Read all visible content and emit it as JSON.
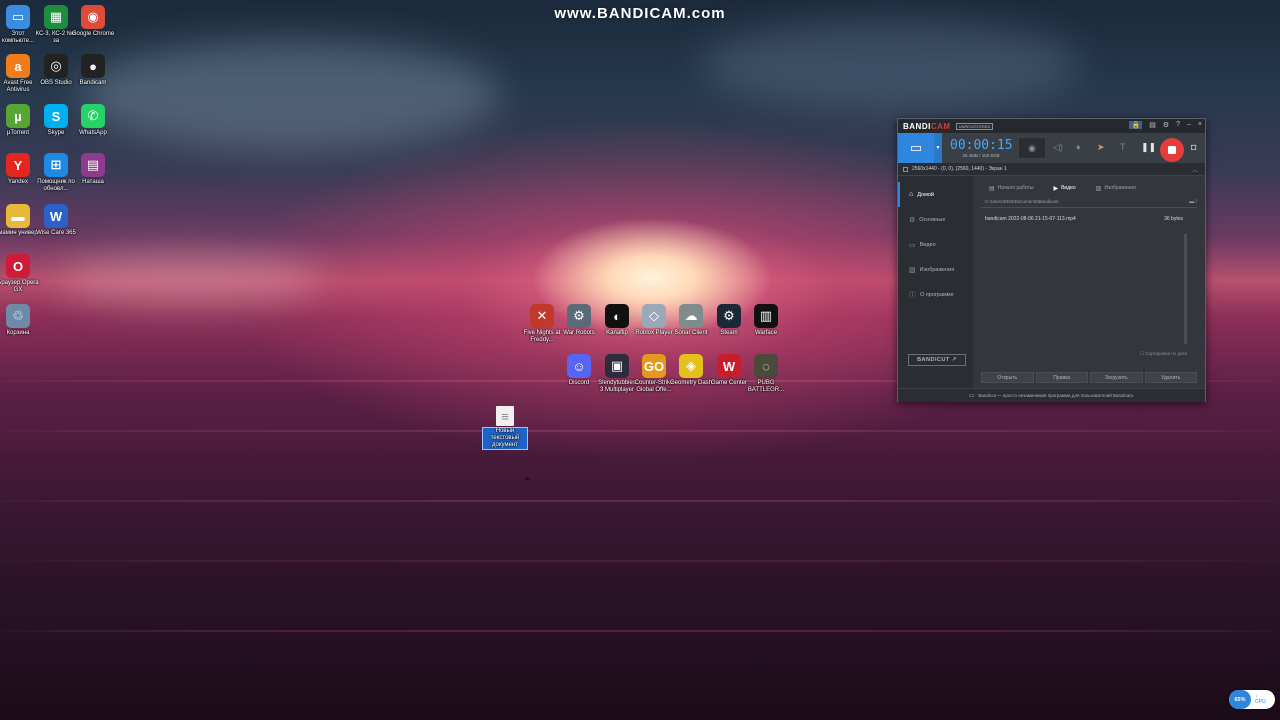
{
  "watermark": "www.BANDICAM.com",
  "colors": {
    "accent": "#2e86de",
    "record_red": "#e53c3c",
    "timer_blue": "#47a8ff"
  },
  "desktop_icons_left": [
    {
      "id": "this-pc",
      "label": "Этот компьюте...",
      "glyph": "▭",
      "bg": "#3b8de0"
    },
    {
      "id": "ks3",
      "label": "КС-3, КС-2 №6 за",
      "glyph": "▦",
      "bg": "#1e8e3e"
    },
    {
      "id": "chrome",
      "label": "Google Chrome",
      "glyph": "◉",
      "bg": "#dd4b39"
    },
    {
      "id": "avast",
      "label": "Avast Free Antivirus",
      "glyph": "a",
      "bg": "#f07d1a"
    },
    {
      "id": "obs",
      "label": "OBS Studio",
      "glyph": "◎",
      "bg": "#222222"
    },
    {
      "id": "bandicam",
      "label": "Bandicam",
      "glyph": "●",
      "bg": "#222222"
    },
    {
      "id": "utorrent",
      "label": "µTorrent",
      "glyph": "µ",
      "bg": "#57a532"
    },
    {
      "id": "skype",
      "label": "Skype",
      "glyph": "S",
      "bg": "#00aff0"
    },
    {
      "id": "whatsapp",
      "label": "WhatsApp",
      "glyph": "✆",
      "bg": "#25d366"
    },
    {
      "id": "yandex",
      "label": "Yandex",
      "glyph": "Y",
      "bg": "#e52620"
    },
    {
      "id": "win-update",
      "label": "Помощник по обновл...",
      "glyph": "⊞",
      "bg": "#1e88e5"
    },
    {
      "id": "natasha",
      "label": "Наташа",
      "glyph": "▤",
      "bg": "#8e3b8e"
    },
    {
      "id": "mamin",
      "label": "мамин универ",
      "glyph": "▬",
      "bg": "#e6b93a"
    },
    {
      "id": "wise-care",
      "label": "Wise Care 365",
      "glyph": "W",
      "bg": "#2a62c9"
    },
    {
      "id": "opera-gx",
      "label": "Браузер Opera GX",
      "glyph": "O",
      "bg": "#d01a3a"
    },
    {
      "id": "recycle-bin",
      "label": "Корзина",
      "glyph": "♲",
      "bg": "#6d8aa8"
    }
  ],
  "desktop_icons_center": [
    {
      "id": "fnaf",
      "label": "Five Nights at Freddy...",
      "glyph": "✕",
      "bg": "#c0392b"
    },
    {
      "id": "war-robots",
      "label": "War Robots",
      "glyph": "⚙",
      "bg": "#5a6a7a"
    },
    {
      "id": "osu",
      "label": "Kanaflip",
      "glyph": "◐",
      "bg": "#111111"
    },
    {
      "id": "roblox",
      "label": "Roblox Player",
      "glyph": "◇",
      "bg": "#9aa8b8"
    },
    {
      "id": "sonic",
      "label": "Sonar Client",
      "glyph": "☁",
      "bg": "#7f8c8d"
    },
    {
      "id": "steam",
      "label": "Steam",
      "glyph": "⚙",
      "bg": "#1b2838"
    },
    {
      "id": "warface",
      "label": "Warface",
      "glyph": "▥",
      "bg": "#111111"
    },
    {
      "id": "discord",
      "label": "Discord",
      "glyph": "☺",
      "bg": "#5865f2"
    },
    {
      "id": "slendytubbies",
      "label": "Slendytubbies 3 Multiplayer",
      "glyph": "▣",
      "bg": "#2c2c3c"
    },
    {
      "id": "cs-go",
      "label": "Counter-Strike Global Offe...",
      "glyph": "GO",
      "bg": "#e39a1c"
    },
    {
      "id": "geometry-dash",
      "label": "Geometry Dash",
      "glyph": "◈",
      "bg": "#e3c01c"
    },
    {
      "id": "game-center",
      "label": "Game Center",
      "glyph": "W",
      "bg": "#c81e2c"
    },
    {
      "id": "pubg",
      "label": "PUBG BATTLEGR...",
      "glyph": "◌",
      "bg": "#4a4a3a"
    }
  ],
  "selected_file": {
    "label": "Новый текстовый документ"
  },
  "bandicam": {
    "brand_a": "BANDI",
    "brand_b": "CAM",
    "unregistered": "UNREGISTERED",
    "timer": "00:00:15",
    "size": "26.4MB / 150.6GB",
    "area": "2560x1440 - (0, 0), (2560, 1440) - Экран 1",
    "sidebar": [
      {
        "icon": "home-icon",
        "glyph": "⌂",
        "label": "Домой"
      },
      {
        "icon": "gear-icon",
        "glyph": "⚙",
        "label": "Основные"
      },
      {
        "icon": "video-icon",
        "glyph": "▭",
        "label": "Видео"
      },
      {
        "icon": "image-icon",
        "glyph": "▨",
        "label": "Изображения"
      },
      {
        "icon": "info-icon",
        "glyph": "ⓘ",
        "label": "О программе"
      }
    ],
    "bandicut": "BANDICUT ↗",
    "tabs": [
      {
        "glyph": "▤",
        "label": "Начало работы"
      },
      {
        "glyph": "▶",
        "label": "Видео"
      },
      {
        "glyph": "▨",
        "label": "Изображения"
      }
    ],
    "path": "C:\\Users\\DNS\\Documents\\Bandicam",
    "file": {
      "name": "bandicam 2022-08-06 21-15-07-113.mp4",
      "size": "36 bytes"
    },
    "sort": "☐ Сортировка по дате",
    "actions": [
      "Открыть",
      "Правка",
      "Загрузить",
      "Удалить"
    ],
    "footer": "Bandicut — просто незаменимая программа для пользователей Bandicam."
  },
  "cpu": {
    "percent": "65%",
    "label": "CPU"
  }
}
